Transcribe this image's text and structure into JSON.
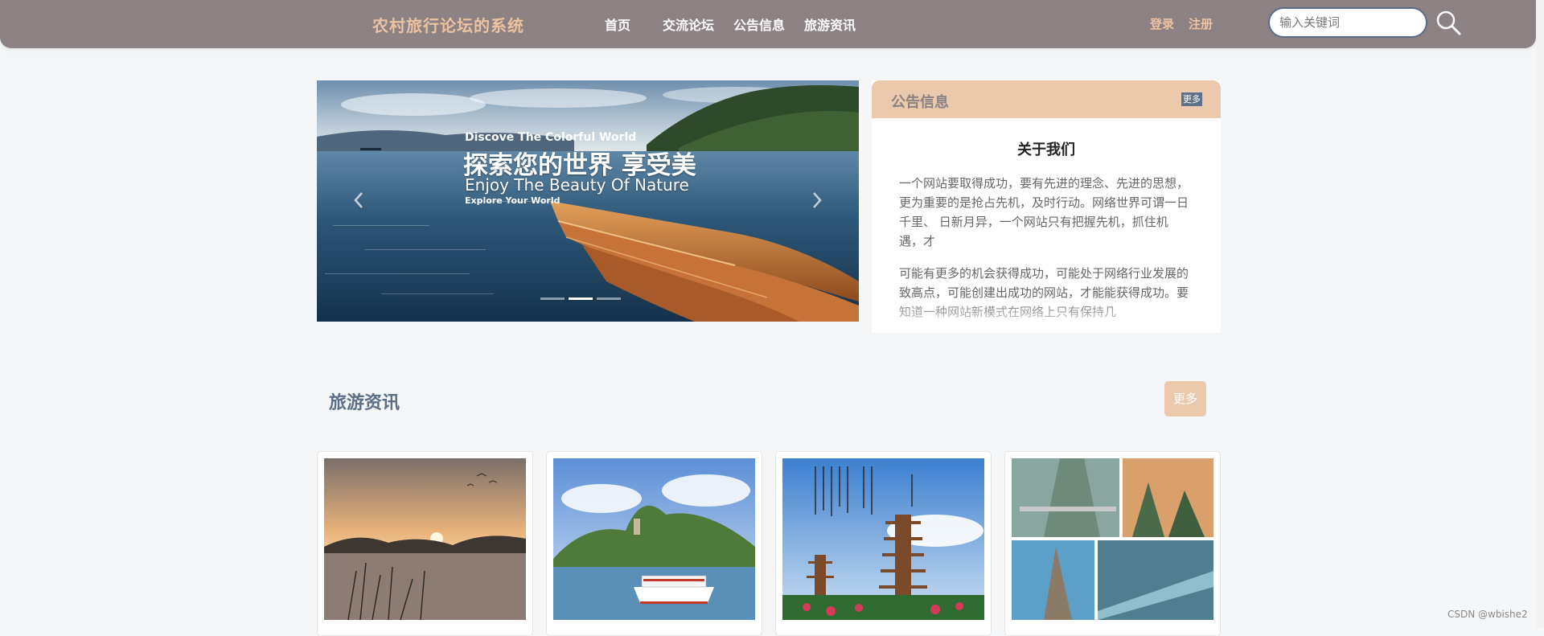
{
  "header": {
    "site_title": "农村旅行论坛的系统",
    "nav": [
      "首页",
      "交流论坛",
      "公告信息",
      "旅游资讯"
    ],
    "login": "登录",
    "register": "注册",
    "search_placeholder": "输入关键词",
    "search_icon": "search-icon"
  },
  "banner": {
    "line_small": "Discove The Colorful World",
    "line_big": "探索您的世界 享受美",
    "line_sub": "Enjoy The Beauty Of Nature",
    "line_tiny": "Explore Your World",
    "prev_icon": "chevron-left-icon",
    "next_icon": "chevron-right-icon",
    "slide_count": 3,
    "active_slide": 2
  },
  "notice": {
    "title": "公告信息",
    "more": "更多",
    "about_title": "关于我们",
    "paragraph1": "一个网站要取得成功，要有先进的理念、先进的思想，更为重要的是抢占先机，及时行动。网络世界可谓一日千里、 日新月异，一个网站只有把握先机，抓住机遇，才",
    "paragraph2": "可能有更多的机会获得成功，可能处于网络行业发展的致高点，可能创建出成功的网站，才能能获得成功。要知道一种网站新模式在网络上只有保持几"
  },
  "news": {
    "title": "旅游资讯",
    "more": "更多"
  },
  "watermark": "CSDN @wbishe2",
  "colors": {
    "header_bg": "#8c8183",
    "accent_peach": "#ebc9ac",
    "title_peach": "#ebc3a1",
    "slate": "#5c6f86",
    "page_bg": "#f4f6f8"
  }
}
